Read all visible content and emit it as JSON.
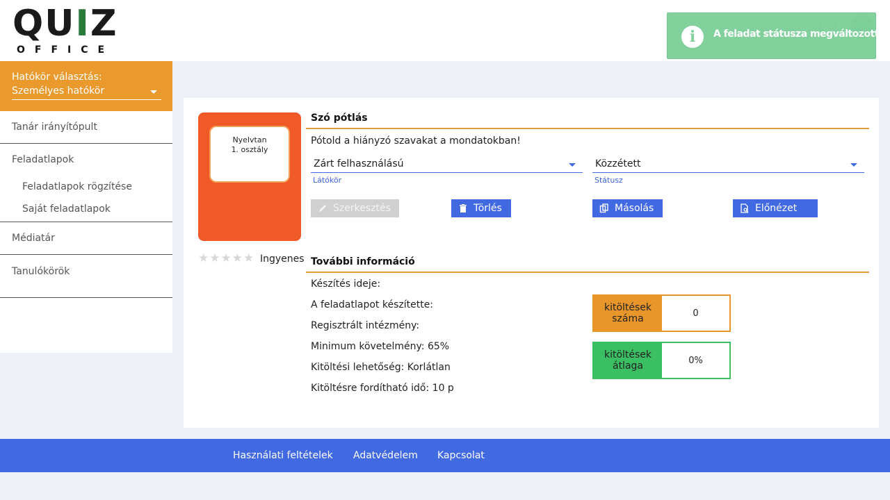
{
  "brand": {
    "letters": [
      "Q",
      "U",
      "I",
      "Z"
    ],
    "letter_colors": [
      "#1a1a1a",
      "#f0a030",
      "#2a7a3a",
      "#1a1a1a"
    ],
    "subtitle": "OFFICE"
  },
  "toast": {
    "icon": "info-icon",
    "text": "A feladat státusza megváltozott."
  },
  "header_icons": [
    "cart-icon",
    "user-icon"
  ],
  "sidebar": {
    "scope_label": "Hatókör választás:",
    "scope_value": "Személyes hatókör",
    "items": [
      {
        "label": "Tanár irányítópult"
      },
      {
        "label": "Feladatlapok",
        "children": [
          "Feladatlapok rögzítése",
          "Saját feladatlapok"
        ]
      },
      {
        "label": "Médiatár"
      },
      {
        "label": "Tanulókörök"
      }
    ]
  },
  "task": {
    "thumb_line1": "Nyelvtan",
    "thumb_line2": "1. osztály",
    "rating": 0,
    "rating_max": 5,
    "price": "Ingyenes",
    "title": "Szó pótlás",
    "description": "Pótold a hiányzó szavakat a mondatokban!",
    "visibility": {
      "value": "Zárt felhasználású",
      "label": "Látókör"
    },
    "status": {
      "value": "Közzétett",
      "label": "Státusz"
    },
    "buttons": {
      "edit": "Szerkesztés",
      "delete": "Törlés",
      "copy": "Másolás",
      "preview": "Előnézet"
    }
  },
  "more_info": {
    "title": "További információ",
    "lines": [
      "Készítés ideje:",
      "A feladatlapot készítette:",
      "Regisztrált intézmény:",
      "Minimum követelmény: 65%",
      "Kitöltési lehetőség: Korlátlan",
      "Kitöltésre fordítható idő: 10 p"
    ],
    "stats": [
      {
        "label_line1": "kitöltések",
        "label_line2": "száma",
        "value": "0",
        "color": "#e8952a"
      },
      {
        "label_line1": "kitöltések",
        "label_line2": "átlaga",
        "value": "0%",
        "color": "#3bbf63"
      }
    ]
  },
  "footer": {
    "links": [
      "Használati feltételek",
      "Adatvédelem",
      "Kapcsolat"
    ]
  },
  "colors": {
    "accent_orange": "#ea9a2c",
    "primary_blue": "#4169e1",
    "toast_green": "#7ccf98",
    "thumb_orange": "#f05a28"
  }
}
